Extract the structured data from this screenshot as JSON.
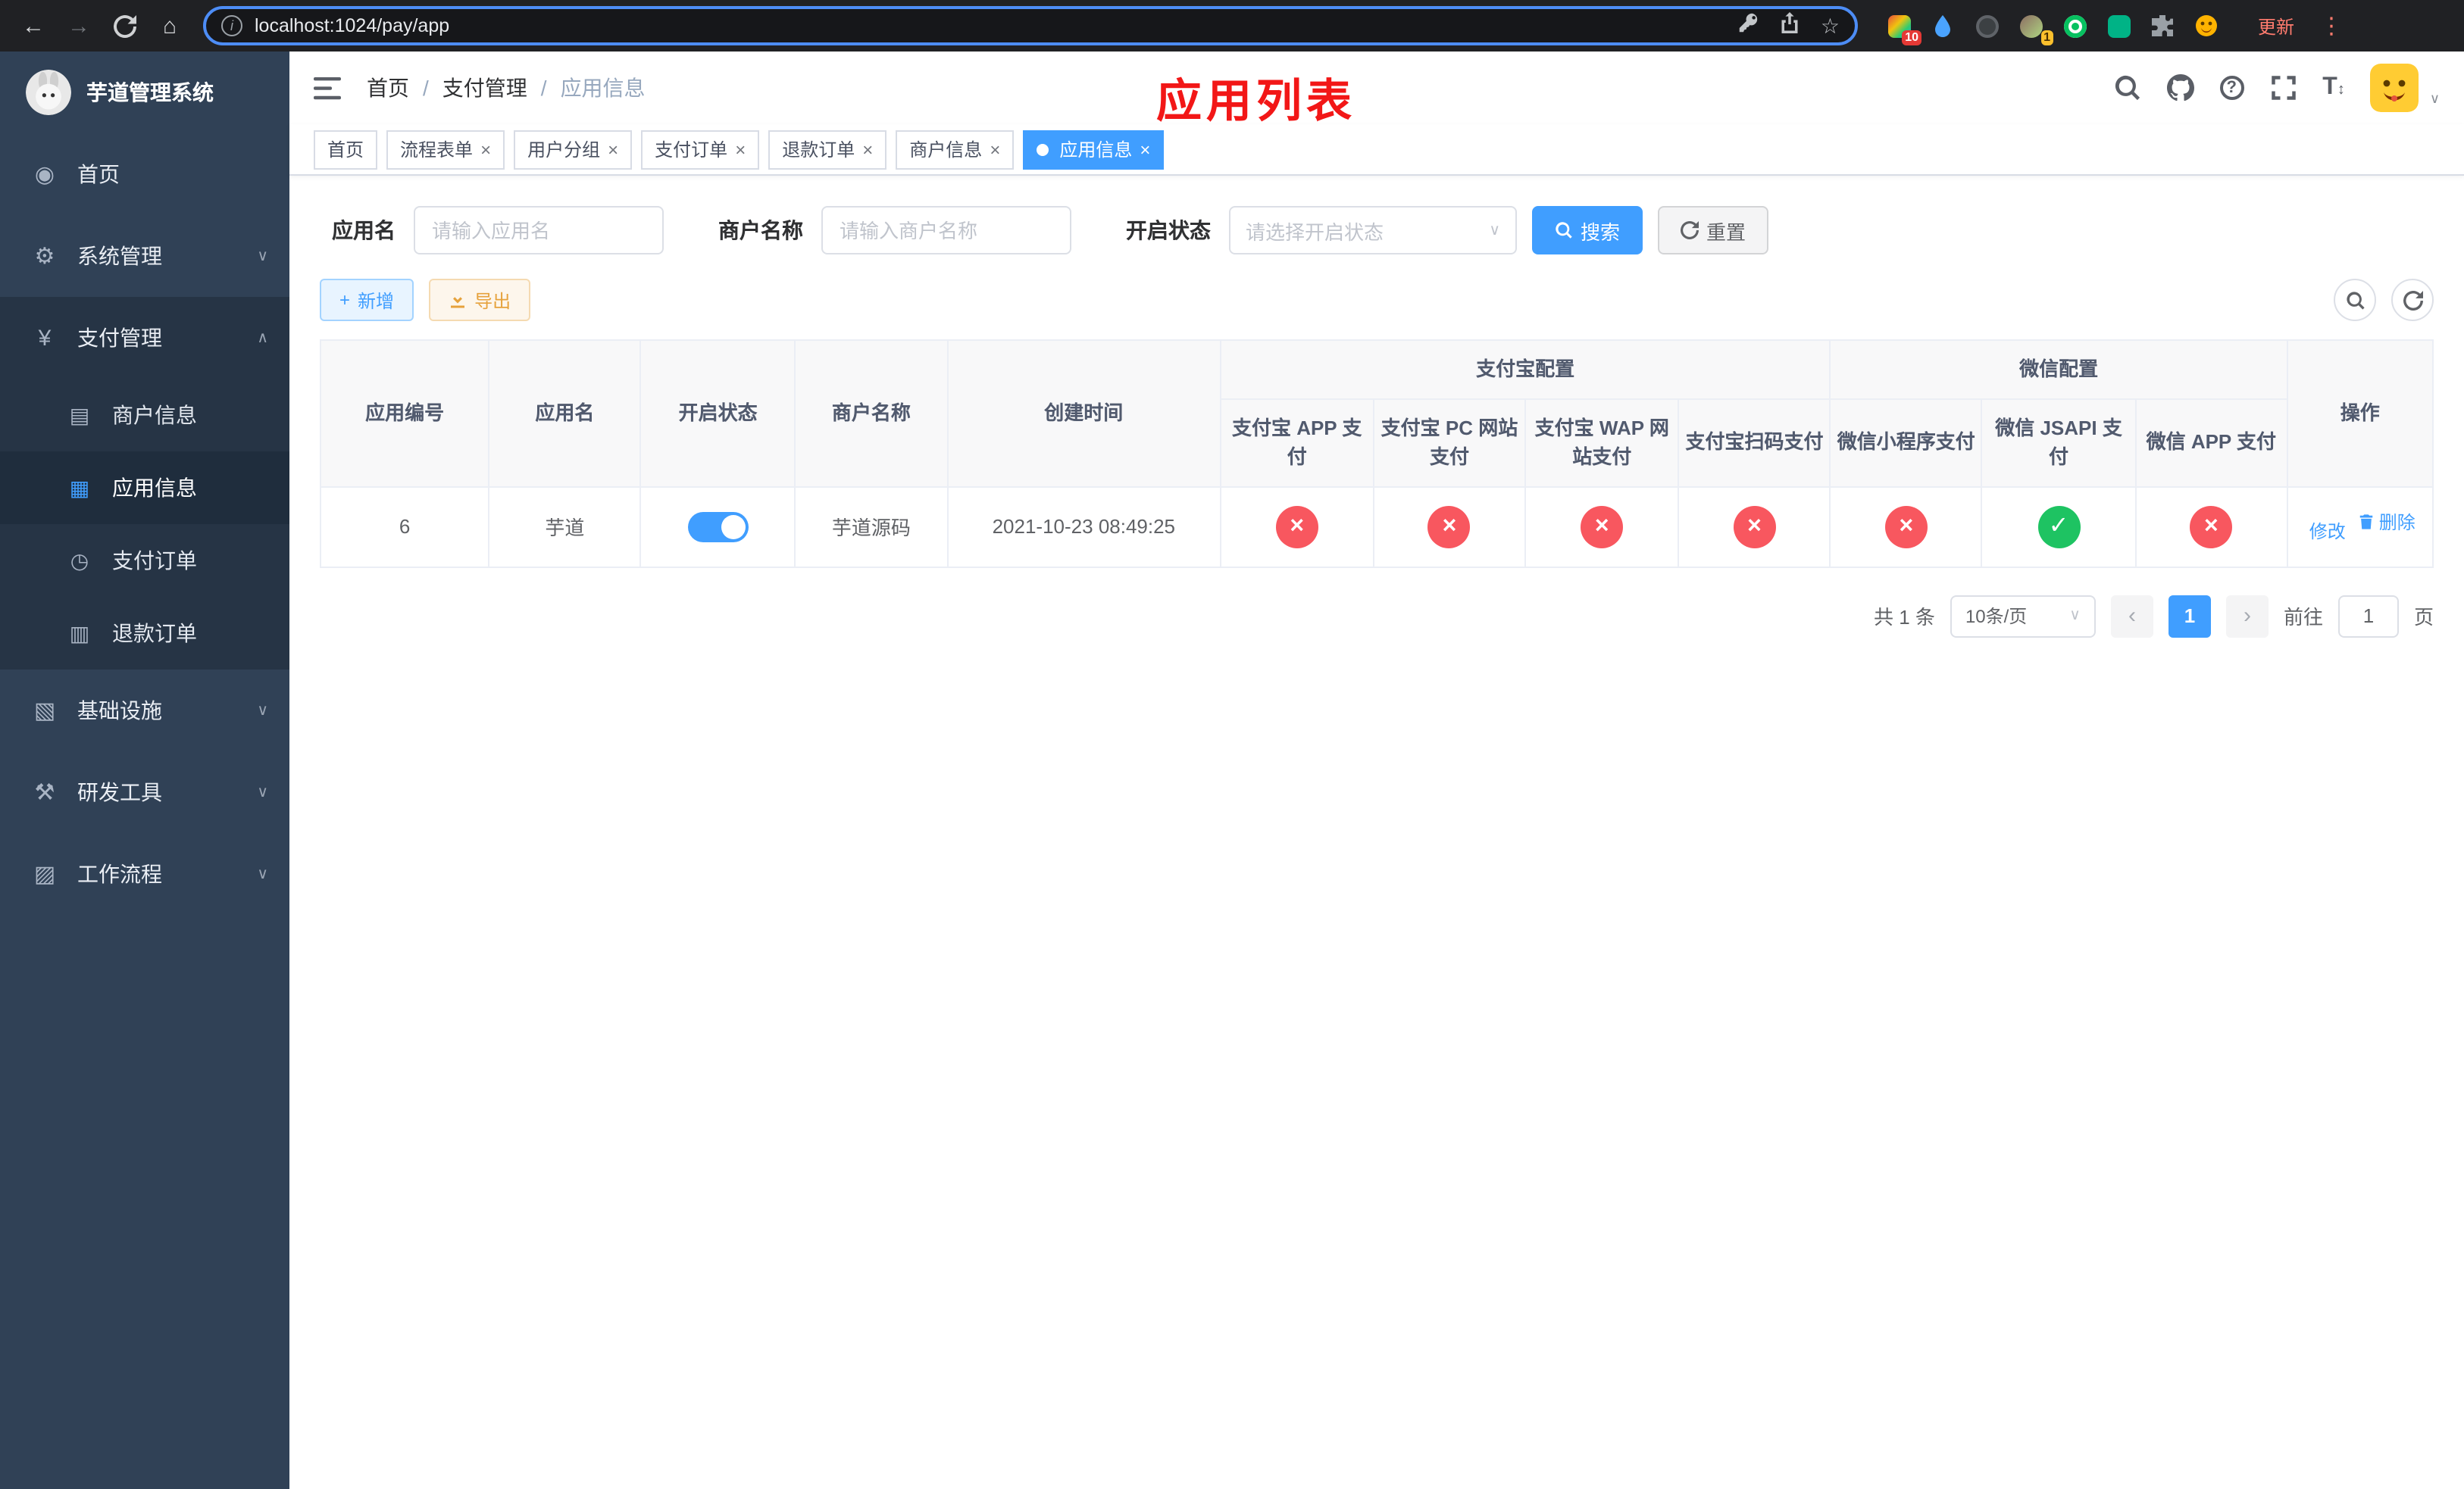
{
  "browser": {
    "url": "localhost:1024/pay/app",
    "update_label": "更新",
    "ext_badge": "10",
    "profile_badge": "1"
  },
  "icons": {
    "back": "←",
    "forward": "→",
    "home_browser": "⌂",
    "star": "☆",
    "dots": "⋮",
    "info": "i",
    "question": "?",
    "menu_home": "◉",
    "menu_system": "⚙",
    "menu_pay": "¥",
    "menu_merchant": "▤",
    "menu_app": "▦",
    "menu_order": "◷",
    "menu_refund": "▥",
    "menu_infra": "▧",
    "menu_dev": "⚒",
    "menu_flow": "▨",
    "chevron_down": "∨",
    "chevron_up": "∧",
    "close": "×",
    "check": "✓",
    "cross": "×",
    "plus": "+",
    "font_big": "T",
    "prev": "‹",
    "next": "›"
  },
  "sidebar": {
    "title": "芋道管理系统",
    "items": [
      {
        "label": "首页"
      },
      {
        "label": "系统管理"
      },
      {
        "label": "支付管理"
      },
      {
        "label": "基础设施"
      },
      {
        "label": "研发工具"
      },
      {
        "label": "工作流程"
      }
    ],
    "subitems": [
      {
        "label": "商户信息"
      },
      {
        "label": "应用信息"
      },
      {
        "label": "支付订单"
      },
      {
        "label": "退款订单"
      }
    ]
  },
  "header": {
    "breadcrumb": [
      "首页",
      "支付管理",
      "应用信息"
    ],
    "annotation": "应用列表"
  },
  "tabs": [
    {
      "label": "首页"
    },
    {
      "label": "流程表单"
    },
    {
      "label": "用户分组"
    },
    {
      "label": "支付订单"
    },
    {
      "label": "退款订单"
    },
    {
      "label": "商户信息"
    },
    {
      "label": "应用信息"
    }
  ],
  "filters": {
    "app_name_label": "应用名",
    "app_name_placeholder": "请输入应用名",
    "merchant_label": "商户名称",
    "merchant_placeholder": "请输入商户名称",
    "status_label": "开启状态",
    "status_placeholder": "请选择开启状态",
    "search_label": "搜索",
    "reset_label": "重置"
  },
  "toolbar": {
    "add_label": "新增",
    "export_label": "导出"
  },
  "table": {
    "alipay_group": "支付宝配置",
    "wechat_group": "微信配置",
    "columns": {
      "id": "应用编号",
      "name": "应用名",
      "status": "开启状态",
      "merchant": "商户名称",
      "created": "创建时间",
      "ops": "操作"
    },
    "alipay_cols": [
      "支付宝 APP 支付",
      "支付宝 PC 网站支付",
      "支付宝 WAP 网站支付",
      "支付宝扫码支付"
    ],
    "wechat_cols": [
      "微信小程序支付",
      "微信 JSAPI 支付",
      "微信 APP 支付"
    ],
    "rows": [
      {
        "id": "6",
        "name": "芋道",
        "enabled": true,
        "merchant": "芋道源码",
        "created": "2021-10-23 08:49:25",
        "channels": [
          "no",
          "no",
          "no",
          "no",
          "no",
          "yes",
          "no"
        ],
        "edit_label": "修改",
        "delete_label": "删除"
      }
    ]
  },
  "pagination": {
    "total": "共 1 条",
    "page_size": "10条/页",
    "page": "1",
    "goto_label": "前往",
    "goto_value": "1",
    "page_unit": "页"
  }
}
